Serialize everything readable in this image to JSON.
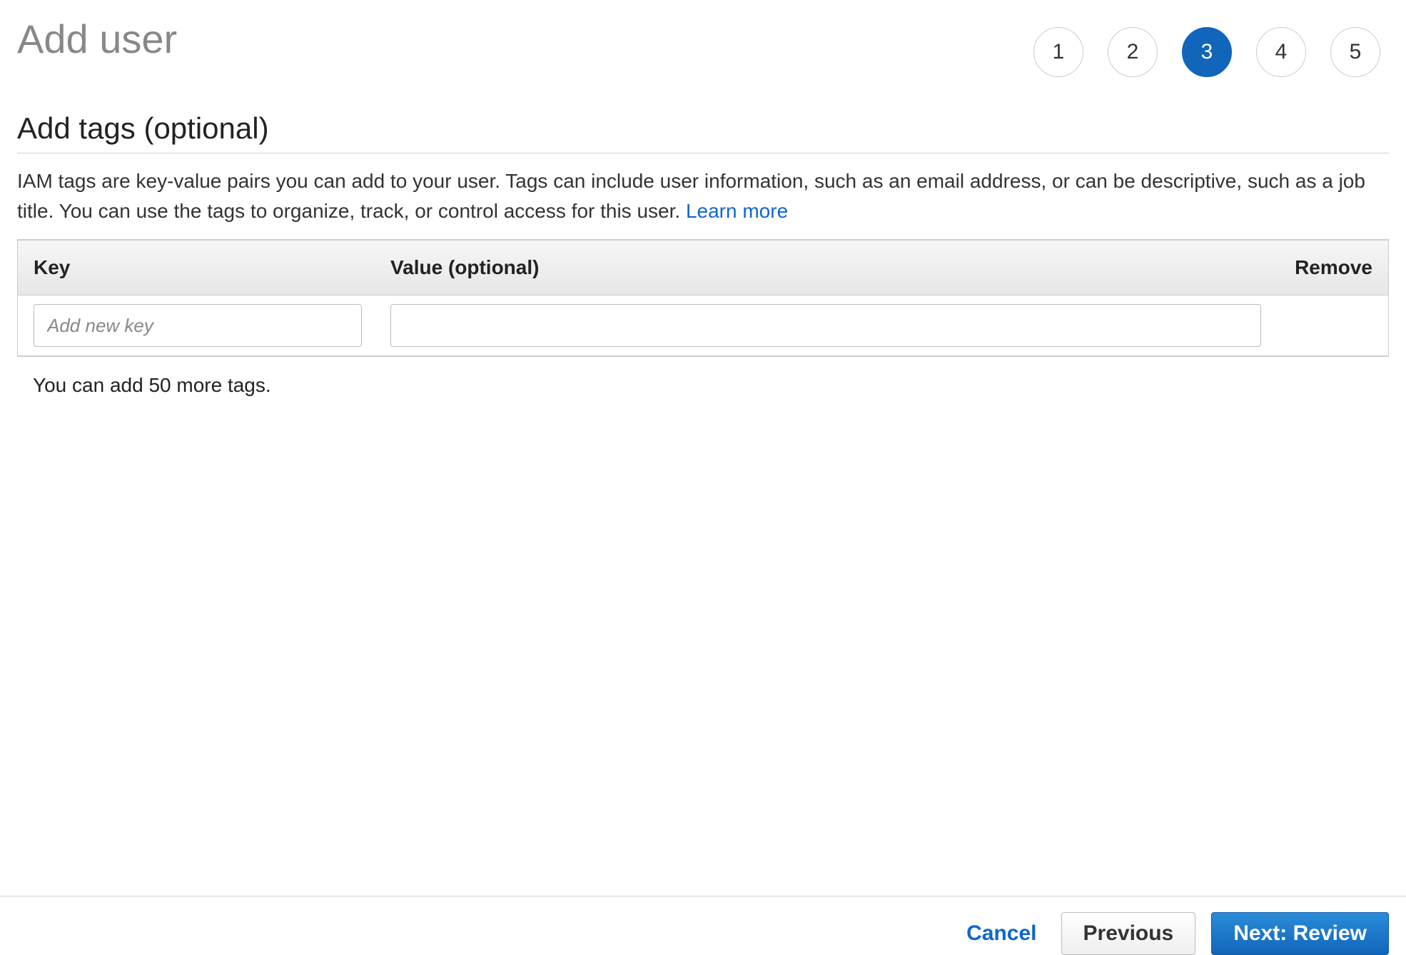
{
  "header": {
    "title": "Add user"
  },
  "steps": {
    "items": [
      "1",
      "2",
      "3",
      "4",
      "5"
    ],
    "active_index": 2
  },
  "section": {
    "title": "Add tags (optional)",
    "description": "IAM tags are key-value pairs you can add to your user. Tags can include user information, such as an email address, or can be descriptive, such as a job title. You can use the tags to organize, track, or control access for this user. ",
    "learn_more": "Learn more"
  },
  "table": {
    "col_key": "Key",
    "col_value": "Value (optional)",
    "col_remove": "Remove",
    "key_placeholder": "Add new key",
    "key_value": "",
    "value_value": ""
  },
  "footer_note": "You can add 50 more tags.",
  "buttons": {
    "cancel": "Cancel",
    "previous": "Previous",
    "next": "Next: Review"
  }
}
